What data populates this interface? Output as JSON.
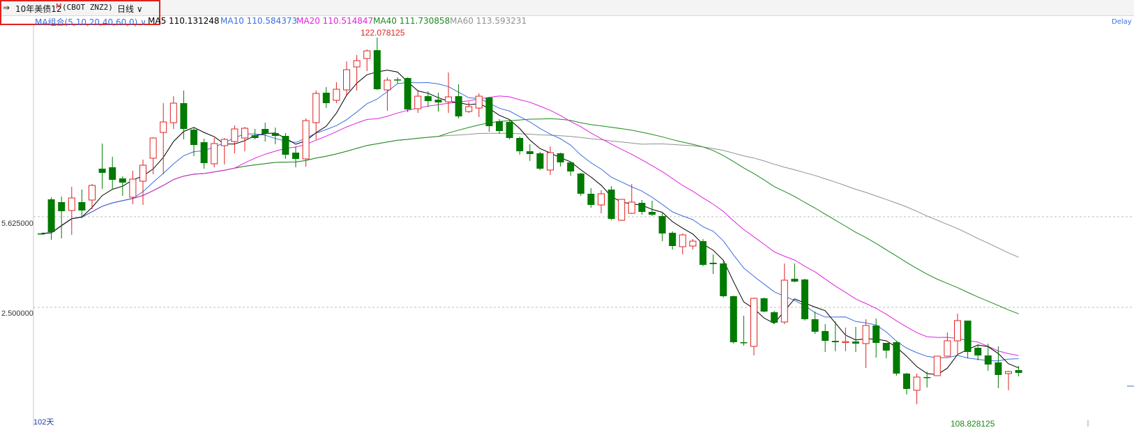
{
  "header": {
    "instrument": "10年美债12",
    "flag": "M",
    "code": "(CBOT ZNZ2)",
    "period": "日线",
    "delay": "Delay"
  },
  "ma": {
    "group_label": "MA组合(5,10,20,40,60,0)",
    "ma5": "MA5 110.131248",
    "ma10": "MA10 110.584373",
    "ma20": "MA20 110.514847",
    "ma40": "MA40 111.730858",
    "ma60": "MA60 113.593231",
    "colors": {
      "ma5": "#000000",
      "ma10": "#3a6fdc",
      "ma20": "#e022e0",
      "ma40": "#1a8a1a",
      "ma60": "#909090"
    }
  },
  "chart_data": {
    "type": "candlestick",
    "y_tick_labels": [
      "5.625000",
      "2.500000"
    ],
    "high_label": "122.078125",
    "low_label": "108.828125",
    "days_label": "102天",
    "colors": {
      "up": "#e02020",
      "down": "#007a00"
    },
    "candles": [
      [
        335,
        335,
        335,
        335
      ],
      [
        286,
        333,
        283,
        344
      ],
      [
        290,
        303,
        282,
        342
      ],
      [
        302,
        284,
        268,
        337
      ],
      [
        290,
        302,
        272,
        313
      ],
      [
        287,
        266,
        264,
        300
      ],
      [
        242,
        248,
        206,
        271
      ],
      [
        240,
        258,
        225,
        272
      ],
      [
        256,
        262,
        253,
        281
      ],
      [
        283,
        257,
        245,
        293
      ],
      [
        260,
        237,
        229,
        294
      ],
      [
        227,
        198,
        197,
        250
      ],
      [
        190,
        175,
        148,
        250
      ],
      [
        176,
        148,
        138,
        185
      ],
      [
        148,
        185,
        130,
        200
      ],
      [
        186,
        208,
        184,
        224
      ],
      [
        204,
        234,
        199,
        242
      ],
      [
        235,
        206,
        198,
        240
      ],
      [
        209,
        200,
        198,
        236
      ],
      [
        203,
        185,
        180,
        220
      ],
      [
        198,
        184,
        182,
        217
      ],
      [
        194,
        198,
        185,
        200
      ],
      [
        185,
        192,
        176,
        203
      ],
      [
        191,
        195,
        183,
        207
      ],
      [
        195,
        222,
        191,
        228
      ],
      [
        219,
        228,
        210,
        240
      ],
      [
        228,
        173,
        170,
        239
      ],
      [
        176,
        134,
        130,
        200
      ],
      [
        133,
        148,
        125,
        155
      ],
      [
        144,
        128,
        118,
        148
      ],
      [
        129,
        100,
        88,
        136
      ],
      [
        96,
        87,
        79,
        130
      ],
      [
        84,
        73,
        71,
        102
      ],
      [
        72,
        128,
        54,
        129
      ],
      [
        129,
        115,
        111,
        159
      ],
      [
        114,
        114,
        111,
        120
      ],
      [
        112,
        157,
        111,
        161
      ],
      [
        156,
        138,
        131,
        162
      ],
      [
        138,
        145,
        131,
        153
      ],
      [
        143,
        147,
        133,
        160
      ],
      [
        146,
        139,
        104,
        162
      ],
      [
        138,
        167,
        121,
        170
      ],
      [
        160,
        153,
        146,
        162
      ],
      [
        155,
        138,
        134,
        168
      ],
      [
        140,
        181,
        139,
        189
      ],
      [
        174,
        188,
        171,
        192
      ],
      [
        175,
        198,
        173,
        200
      ],
      [
        198,
        217,
        196,
        222
      ],
      [
        217,
        221,
        207,
        231
      ],
      [
        220,
        242,
        218,
        244
      ],
      [
        244,
        219,
        210,
        251
      ],
      [
        220,
        233,
        219,
        239
      ],
      [
        233,
        246,
        232,
        252
      ],
      [
        249,
        278,
        248,
        281
      ],
      [
        278,
        294,
        270,
        298
      ],
      [
        294,
        278,
        273,
        306
      ],
      [
        272,
        314,
        267,
        316
      ],
      [
        316,
        286,
        286,
        317
      ],
      [
        306,
        290,
        264,
        307
      ],
      [
        291,
        304,
        287,
        308
      ],
      [
        304,
        308,
        288,
        310
      ],
      [
        310,
        335,
        306,
        346
      ],
      [
        334,
        353,
        332,
        358
      ],
      [
        354,
        337,
        335,
        365
      ],
      [
        353,
        346,
        343,
        358
      ],
      [
        346,
        380,
        343,
        382
      ],
      [
        377,
        379,
        365,
        393
      ],
      [
        378,
        425,
        374,
        427
      ],
      [
        425,
        491,
        424,
        493
      ],
      [
        491,
        491,
        453,
        496
      ],
      [
        497,
        428,
        427,
        510
      ],
      [
        428,
        447,
        427,
        448
      ],
      [
        448,
        463,
        446,
        464
      ],
      [
        462,
        402,
        378,
        465
      ],
      [
        400,
        404,
        378,
        405
      ],
      [
        401,
        458,
        400,
        460
      ],
      [
        458,
        476,
        447,
        479
      ],
      [
        475,
        489,
        465,
        505
      ],
      [
        489,
        491,
        461,
        504
      ],
      [
        491,
        490,
        470,
        504
      ],
      [
        490,
        493,
        469,
        505
      ],
      [
        493,
        467,
        458,
        528
      ],
      [
        467,
        492,
        457,
        513
      ],
      [
        492,
        503,
        496,
        514
      ],
      [
        491,
        536,
        489,
        539
      ],
      [
        536,
        558,
        535,
        566
      ],
      [
        560,
        541,
        536,
        580
      ],
      [
        541,
        542,
        533,
        556
      ],
      [
        539,
        511,
        511,
        530
      ],
      [
        511,
        489,
        477,
        512
      ],
      [
        489,
        460,
        450,
        510
      ],
      [
        460,
        505,
        460,
        514
      ],
      [
        499,
        510,
        494,
        517
      ],
      [
        510,
        523,
        493,
        532
      ],
      [
        520,
        538,
        497,
        557
      ],
      [
        536,
        533,
        532,
        560
      ],
      [
        531,
        535,
        525,
        540
      ]
    ]
  }
}
